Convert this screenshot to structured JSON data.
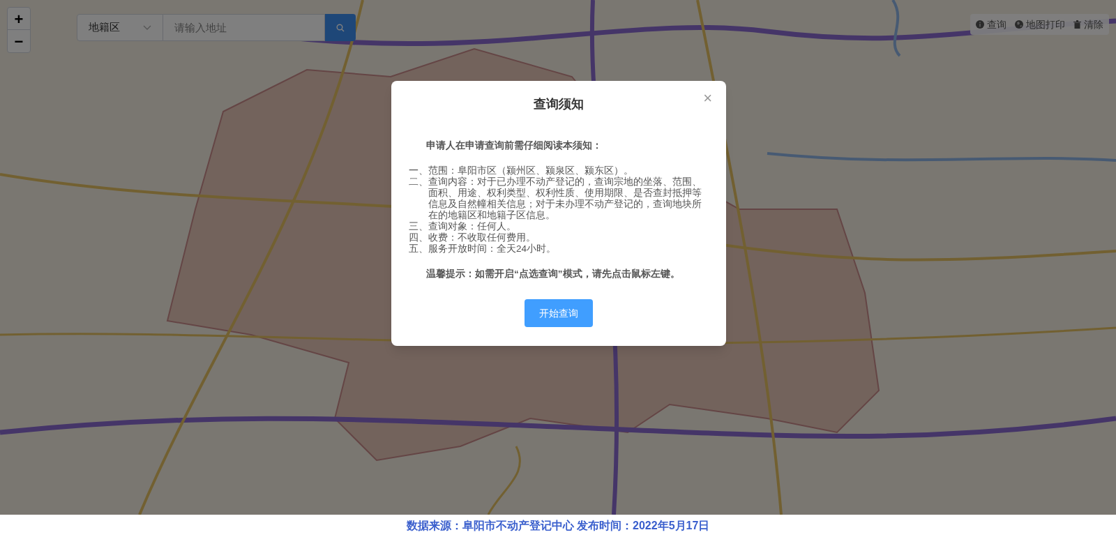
{
  "map": {
    "kind": "picture",
    "zoom_controls": [
      "+",
      "−"
    ],
    "district_select": {
      "value": "地籍区"
    },
    "search": {
      "placeholder": "请输入地址"
    },
    "toolbar": [
      {
        "kind": "info",
        "label": "查询"
      },
      {
        "kind": "globe",
        "label": "地图打印"
      },
      {
        "kind": "trash",
        "label": "清除"
      }
    ]
  },
  "dialog": {
    "title": "查询须知",
    "close": "×",
    "intro": "申请人在申请查询前需仔细阅读本须知：",
    "items": [
      {
        "marker": "一、",
        "text": "范围：阜阳市区（颍州区、颍泉区、颍东区）。"
      },
      {
        "marker": "二、",
        "text": "查询内容：对于已办理不动产登记的，查询宗地的坐落、范围、面积、用途、权利类型、权利性质、使用期限、是否查封抵押等信息及自然幢相关信息；对于未办理不动产登记的，查询地块所在的地籍区和地籍子区信息。"
      },
      {
        "marker": "三、",
        "text": "查询对象：任何人。"
      },
      {
        "marker": "四、",
        "text": "收费：不收取任何费用。"
      },
      {
        "marker": "五、",
        "text": "服务开放时间：全天24小时。"
      }
    ],
    "tip": "温馨提示：如需开启“点选查询”模式，请先点击鼠标左键。",
    "button": "开始查询"
  },
  "footer": "数据来源：阜阳市不动产登记中心 发布时间：2022年5月17日"
}
